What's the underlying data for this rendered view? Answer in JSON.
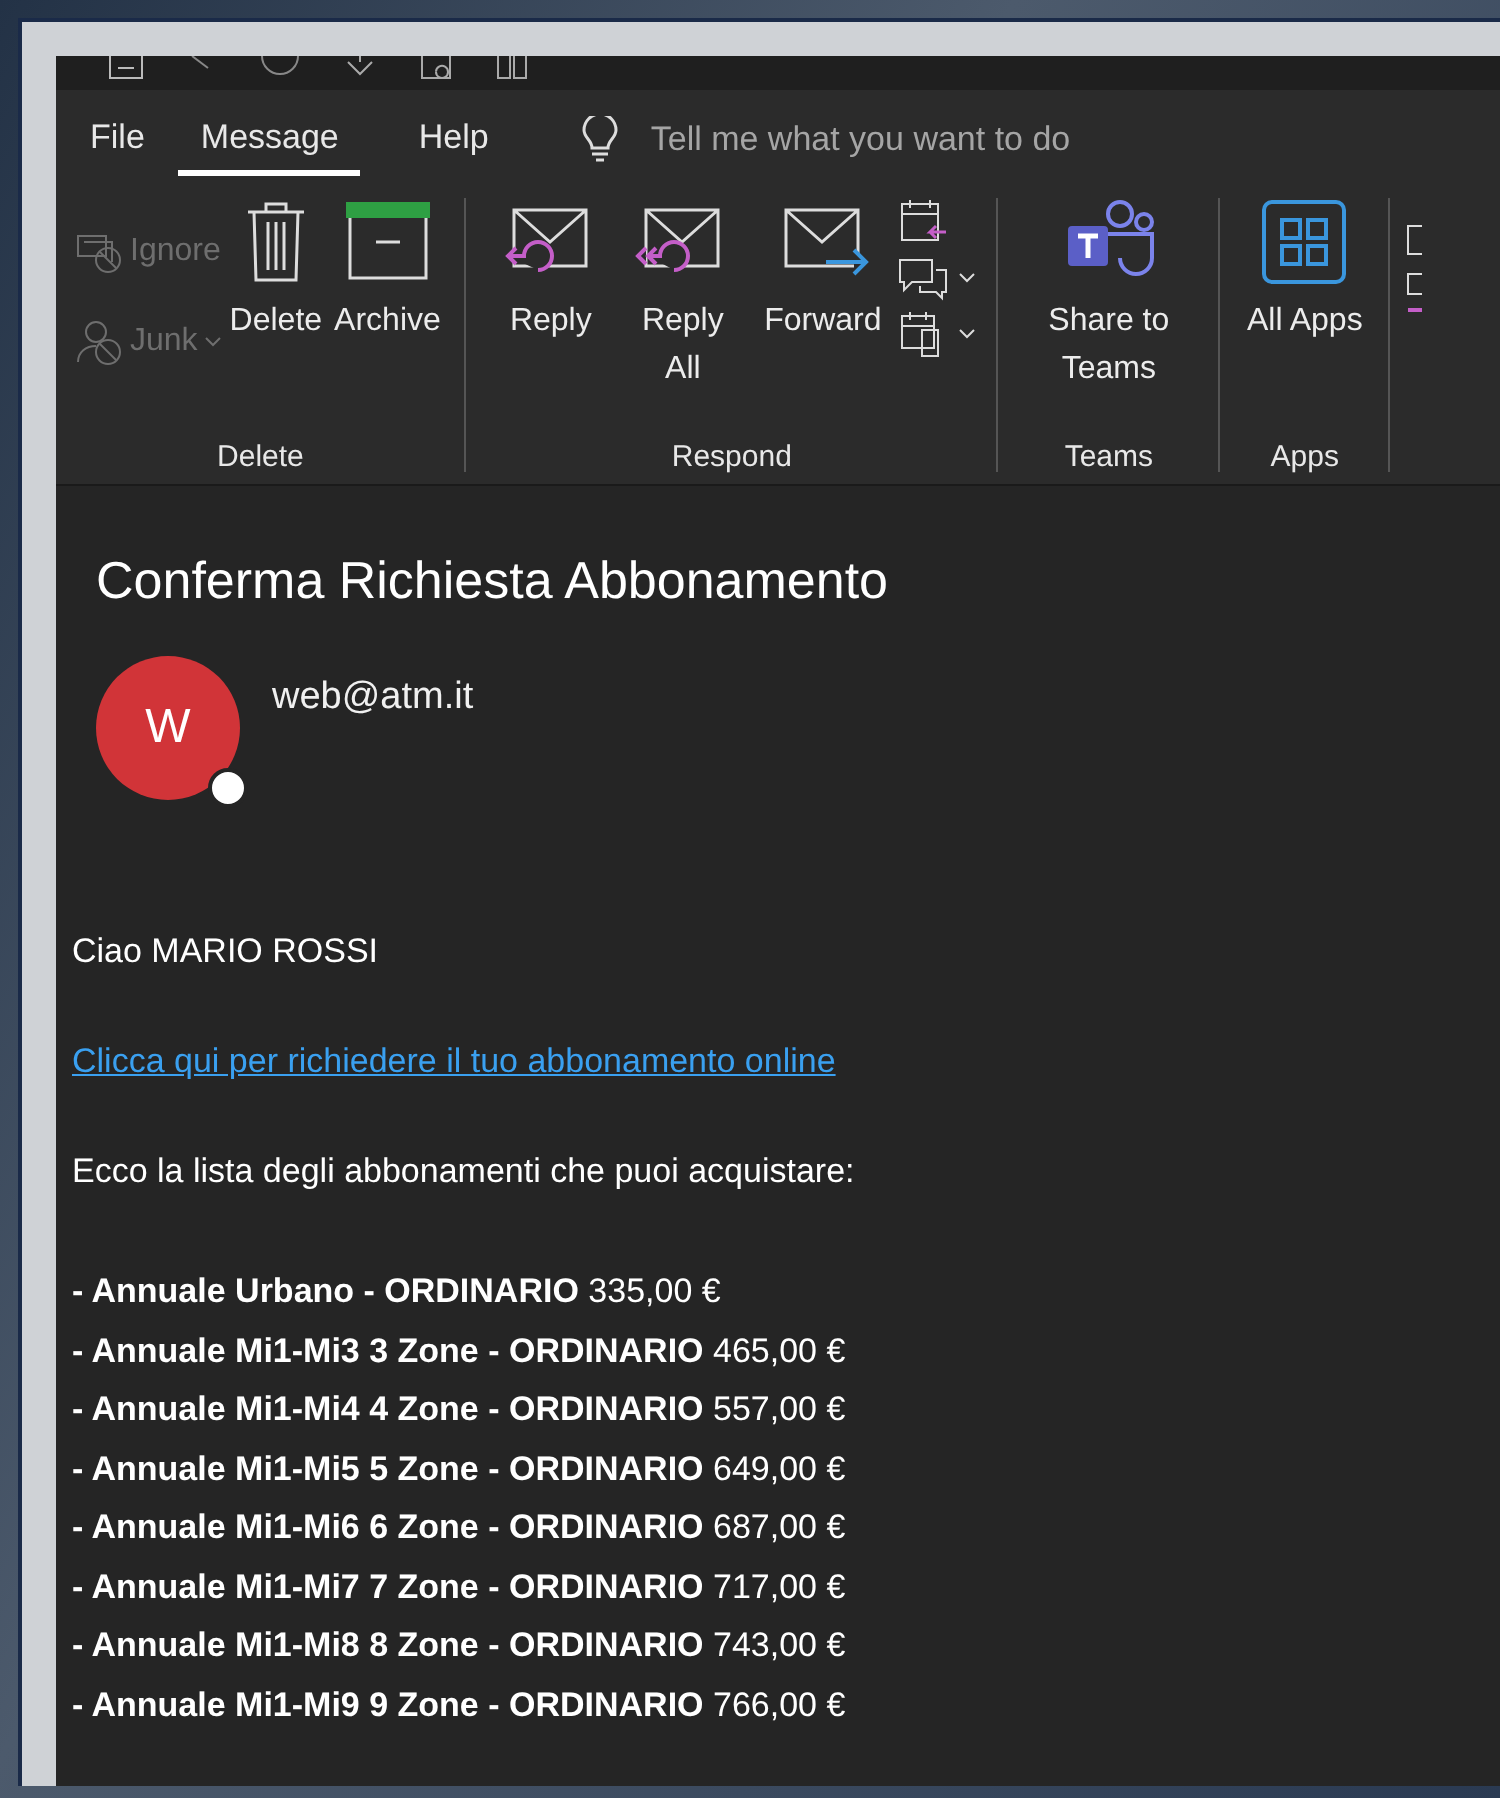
{
  "tabs": [
    {
      "label": "File",
      "selected": false
    },
    {
      "label": "Message",
      "selected": true
    },
    {
      "label": "Help",
      "selected": false
    }
  ],
  "tell_me": {
    "placeholder": "Tell me what you want to do"
  },
  "ribbon": {
    "groups": [
      {
        "label": "Delete",
        "small": [
          {
            "label": "Ignore",
            "disabled": true
          },
          {
            "label": "Junk",
            "disabled": true
          }
        ],
        "buttons": [
          {
            "label": "Delete"
          },
          {
            "label": "Archive"
          }
        ]
      },
      {
        "label": "Respond",
        "buttons": [
          {
            "label": "Reply"
          },
          {
            "label": "Reply All"
          },
          {
            "label": "Forward"
          }
        ]
      },
      {
        "label": "Teams",
        "buttons": [
          {
            "label": "Share to Teams"
          }
        ]
      },
      {
        "label": "Apps",
        "buttons": [
          {
            "label": "All Apps"
          }
        ]
      }
    ]
  },
  "message": {
    "subject": "Conferma Richiesta Abbonamento",
    "avatar_initial": "W",
    "sender": "web@atm.it",
    "greeting": "Ciao MARIO ROSSI",
    "link": "Clicca qui per richiedere il tuo abbonamento online",
    "intro": "Ecco la lista degli abbonamenti che puoi acquistare:",
    "items": [
      "**- Annuale Urbano - ORDINARIO** 335,00 €",
      "**- Annuale Mi1-Mi3 3 Zone - ORDINARIO** 465,00 €",
      "**- Annuale Mi1-Mi4 4 Zone - ORDINARIO** 557,00 €",
      "**- Annuale Mi1-Mi5 5 Zone - ORDINARIO** 649,00 €",
      "**- Annuale Mi1-Mi6 6 Zone - ORDINARIO** 687,00 €",
      "**- Annuale Mi1-Mi7 7 Zone - ORDINARIO** 717,00 €",
      "**- Annuale Mi1-Mi8 8 Zone - ORDINARIO** 743,00 €",
      "**- Annuale Mi1-Mi9 9 Zone - ORDINARIO** 766,00 €"
    ]
  }
}
